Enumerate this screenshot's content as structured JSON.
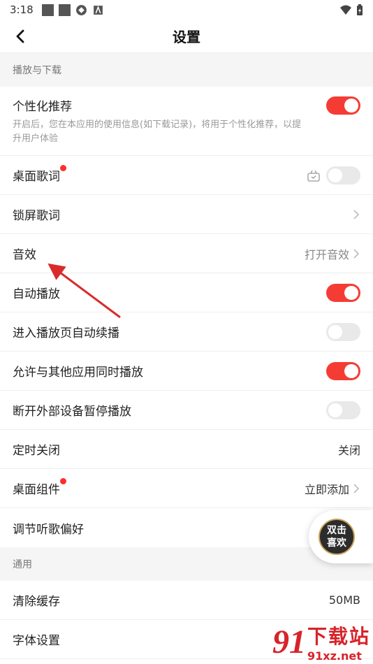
{
  "status_bar": {
    "time": "3:18"
  },
  "header": {
    "title": "设置"
  },
  "sections": [
    {
      "title": "播放与下载"
    },
    {
      "title": "通用"
    }
  ],
  "rows": {
    "personalized": {
      "label": "个性化推荐",
      "desc": "开启后，您在本应用的使用信息(如下载记录)，将用于个性化推荐，以提升用户体验",
      "toggle": "on"
    },
    "desktop_lyrics": {
      "label": "桌面歌词",
      "toggle": "off"
    },
    "lockscreen_lyrics": {
      "label": "锁屏歌词"
    },
    "sound_effect": {
      "label": "音效",
      "value": "打开音效"
    },
    "autoplay": {
      "label": "自动播放",
      "toggle": "on"
    },
    "auto_continue": {
      "label": "进入播放页自动续播",
      "toggle": "off"
    },
    "mix_play": {
      "label": "允许与其他应用同时播放",
      "toggle": "on"
    },
    "pause_disconnect": {
      "label": "断开外部设备暂停播放",
      "toggle": "off"
    },
    "timer_close": {
      "label": "定时关闭",
      "value": "关闭"
    },
    "desktop_widget": {
      "label": "桌面组件",
      "value": "立即添加"
    },
    "preference": {
      "label": "调节听歌偏好"
    },
    "clear_cache": {
      "label": "清除缓存",
      "value": "50MB"
    },
    "font_settings": {
      "label": "字体设置"
    }
  },
  "float_button": {
    "line1": "双击",
    "line2": "喜欢"
  },
  "watermark": {
    "number": "91",
    "site_cn": "下载站",
    "url": "91xz.net"
  },
  "colors": {
    "accent": "#f53c34",
    "toggle_off": "#e9e9e9",
    "section_bg": "#f5f5f5"
  }
}
